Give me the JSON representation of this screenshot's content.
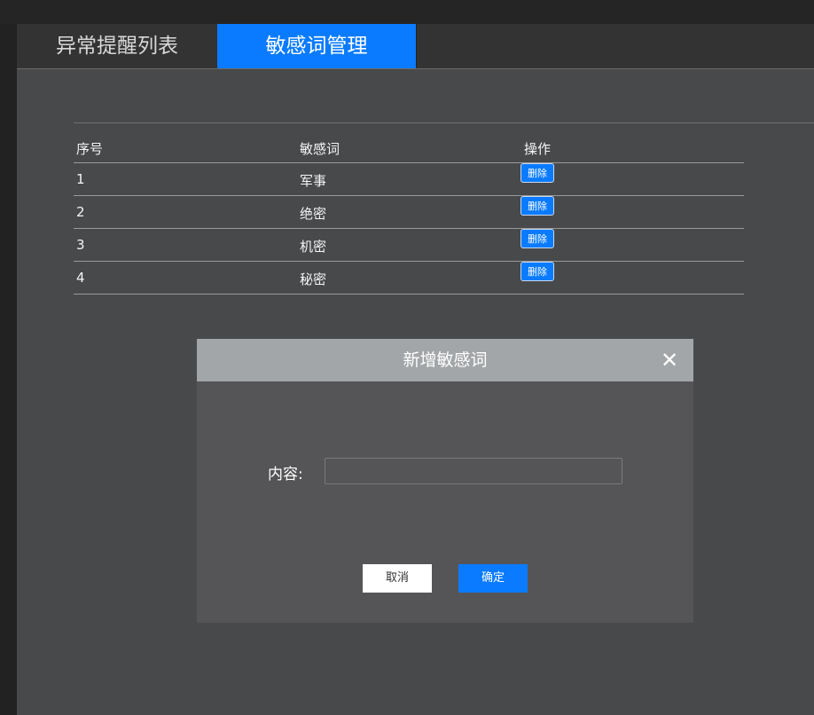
{
  "tabs": [
    {
      "label": "异常提醒列表",
      "active": false
    },
    {
      "label": "敏感词管理",
      "active": true
    }
  ],
  "table": {
    "headers": [
      "序号",
      "敏感词",
      "操作"
    ],
    "rows": [
      {
        "index": "1",
        "word": "军事",
        "action": "删除"
      },
      {
        "index": "2",
        "word": "绝密",
        "action": "删除"
      },
      {
        "index": "3",
        "word": "机密",
        "action": "删除"
      },
      {
        "index": "4",
        "word": "秘密",
        "action": "删除"
      }
    ]
  },
  "dialog": {
    "title": "新增敏感词",
    "close_icon": "close-icon",
    "content_label": "内容:",
    "content_value": "",
    "content_placeholder": "",
    "cancel_label": "取消",
    "confirm_label": "确定"
  },
  "colors": {
    "accent": "#0a7bff",
    "panel_bg": "#48494b",
    "dialog_header": "#a3a6a8",
    "dialog_body": "#555557"
  }
}
